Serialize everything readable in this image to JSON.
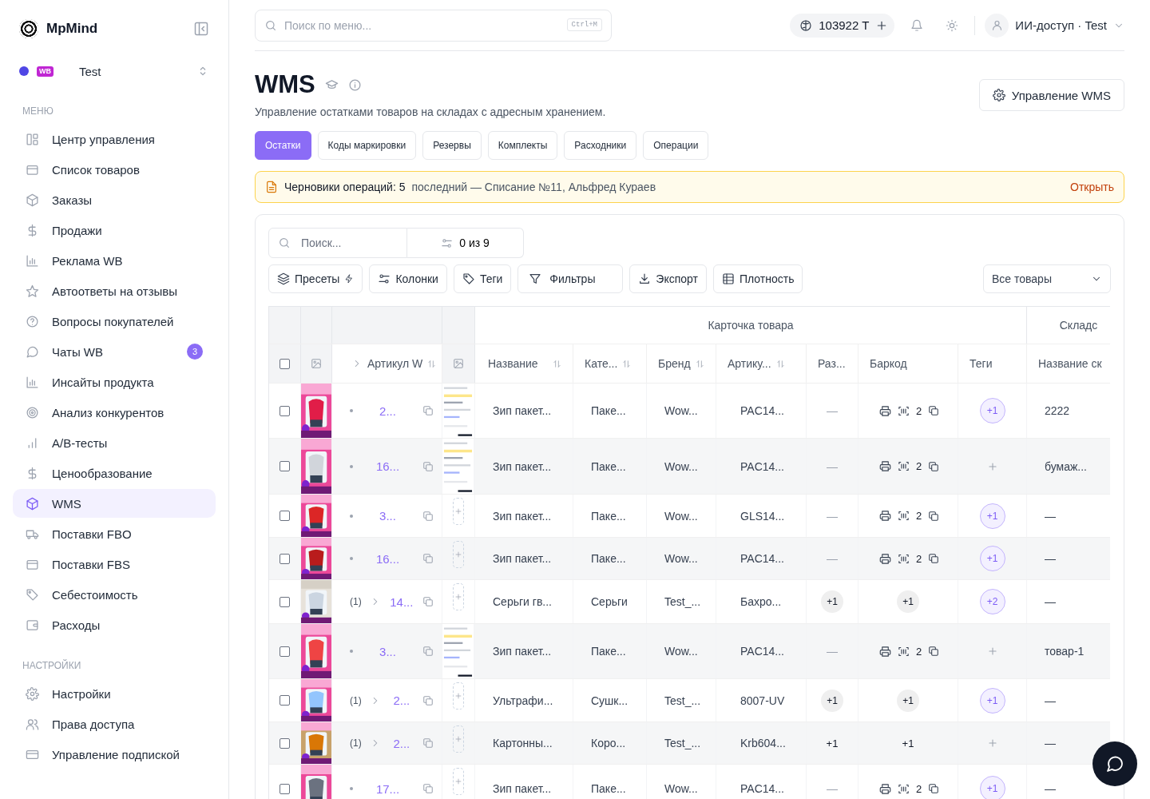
{
  "sidebar": {
    "brand": "MpMind",
    "account": {
      "name": "Test",
      "color": "#4f46e5",
      "marketplace": "WB"
    },
    "sections": [
      {
        "title": "МЕНЮ",
        "items": [
          {
            "label": "Центр управления",
            "selected": false
          },
          {
            "label": "Список товаров",
            "selected": false
          },
          {
            "label": "Заказы",
            "selected": false
          },
          {
            "label": "Продажи",
            "selected": false
          },
          {
            "label": "Реклама WB",
            "selected": false
          },
          {
            "label": "Автоответы на отзывы",
            "selected": false
          },
          {
            "label": "Вопросы покупателей",
            "selected": false
          },
          {
            "label": "Чаты WB",
            "selected": false,
            "badge": "3"
          },
          {
            "label": "Инсайты продукта",
            "selected": false
          },
          {
            "label": "Анализ конкурентов",
            "selected": false
          },
          {
            "label": "A/B-тесты",
            "selected": false
          },
          {
            "label": "Ценообразование",
            "selected": false
          },
          {
            "label": "WMS",
            "selected": true
          },
          {
            "label": "Поставки FBO",
            "selected": false
          },
          {
            "label": "Поставки FBS",
            "selected": false
          },
          {
            "label": "Себестоимость",
            "selected": false
          },
          {
            "label": "Расходы",
            "selected": false
          }
        ]
      },
      {
        "title": "НАСТРОЙКИ",
        "items": [
          {
            "label": "Настройки",
            "selected": false
          },
          {
            "label": "Права доступа",
            "selected": false
          },
          {
            "label": "Управление подпиской",
            "selected": false
          }
        ]
      }
    ]
  },
  "topbar": {
    "search": {
      "placeholder": "Поиск по меню...",
      "shortcut": "Ctrl+M"
    },
    "tokens": "103922 T",
    "user": "ИИ-доступ · Test"
  },
  "header": {
    "title": "WMS",
    "subtitle": "Управление остатками товаров на складах с адресным хранением.",
    "action": "Управление WMS"
  },
  "tabs": [
    {
      "label": "Остатки",
      "selected": true
    },
    {
      "label": "Коды маркировки",
      "selected": false
    },
    {
      "label": "Резервы",
      "selected": false
    },
    {
      "label": "Комплекты",
      "selected": false
    },
    {
      "label": "Расходники",
      "selected": false
    },
    {
      "label": "Операции",
      "selected": false
    }
  ],
  "notice": {
    "title": "Черновики операций: 5",
    "detail": "последний — Списание №11, Альфред Кураев",
    "action": "Открыть"
  },
  "toolbar": {
    "search": {
      "placeholder": "Поиск..."
    },
    "filter_count": "0 из 9",
    "buttons": [
      "Пресеты",
      "Колонки",
      "Теги",
      "Фильтры",
      "Экспорт",
      "Плотность"
    ],
    "scope": "Все товары"
  },
  "table": {
    "all_selected": false,
    "groups": [
      "Карточка товара",
      "Складс"
    ],
    "columns": [
      "Артикул W",
      "Название",
      "Кате...",
      "Бренд",
      "Артику...",
      "Раз...",
      "Баркод",
      "Теги",
      "Название ск"
    ],
    "rows": [
      {
        "selected": false,
        "group_count": null,
        "article": "2...",
        "has_image": true,
        "name": "Зип пакет...",
        "category": "Паке...",
        "brand": "Wow...",
        "vendor_code": "PAC14...",
        "size": {
          "kind": "dash",
          "text": "—"
        },
        "barcode": {
          "kind": "icons",
          "text": "2"
        },
        "tags": {
          "kind": "chip",
          "text": "+1"
        },
        "warehouse": "2222"
      },
      {
        "selected": false,
        "group_count": null,
        "article": "16...",
        "has_image": true,
        "name": "Зип пакет...",
        "category": "Паке...",
        "brand": "Wow...",
        "vendor_code": "PAC14...",
        "size": {
          "kind": "dash",
          "text": "—"
        },
        "barcode": {
          "kind": "icons",
          "text": "2"
        },
        "tags": {
          "kind": "add"
        },
        "warehouse": "бумаж..."
      },
      {
        "selected": false,
        "group_count": null,
        "article": "3...",
        "has_image": false,
        "name": "Зип пакет...",
        "category": "Паке...",
        "brand": "Wow...",
        "vendor_code": "GLS14...",
        "size": {
          "kind": "dash",
          "text": "—"
        },
        "barcode": {
          "kind": "icons",
          "text": "2"
        },
        "tags": {
          "kind": "chip",
          "text": "+1"
        },
        "warehouse": "—"
      },
      {
        "selected": false,
        "group_count": null,
        "article": "16...",
        "has_image": false,
        "name": "Зип пакет...",
        "category": "Паке...",
        "brand": "Wow...",
        "vendor_code": "PAC14...",
        "size": {
          "kind": "dash",
          "text": "—"
        },
        "barcode": {
          "kind": "icons",
          "text": "2"
        },
        "tags": {
          "kind": "chip",
          "text": "+1"
        },
        "warehouse": "—"
      },
      {
        "selected": false,
        "group_count": "(1)",
        "article": "14...",
        "has_image": false,
        "name": "Серьги гв...",
        "category": "Серьги",
        "brand": "Test_...",
        "vendor_code": "Бахро...",
        "size": {
          "kind": "chip",
          "text": "+1"
        },
        "barcode": {
          "kind": "chip",
          "text": "+1"
        },
        "tags": {
          "kind": "chip",
          "text": "+2"
        },
        "warehouse": "—"
      },
      {
        "selected": false,
        "group_count": null,
        "article": "3...",
        "has_image": true,
        "name": "Зип пакет...",
        "category": "Паке...",
        "brand": "Wow...",
        "vendor_code": "PAC14...",
        "size": {
          "kind": "dash",
          "text": "—"
        },
        "barcode": {
          "kind": "icons",
          "text": "2"
        },
        "tags": {
          "kind": "add"
        },
        "warehouse": "товар-1"
      },
      {
        "selected": false,
        "group_count": "(1)",
        "article": "2...",
        "has_image": false,
        "name": "Ультрафи...",
        "category": "Сушк...",
        "brand": "Test_...",
        "vendor_code": "8007-UV",
        "size": {
          "kind": "chip",
          "text": "+1"
        },
        "barcode": {
          "kind": "chip",
          "text": "+1"
        },
        "tags": {
          "kind": "chip",
          "text": "+1"
        },
        "warehouse": "—"
      },
      {
        "selected": false,
        "group_count": "(1)",
        "article": "2...",
        "has_image": false,
        "name": "Картонны...",
        "category": "Коро...",
        "brand": "Test_...",
        "vendor_code": "Krb604...",
        "size": {
          "kind": "plain",
          "text": "+1"
        },
        "barcode": {
          "kind": "plain",
          "text": "+1"
        },
        "tags": {
          "kind": "add"
        },
        "warehouse": "—"
      },
      {
        "selected": false,
        "group_count": null,
        "article": "17...",
        "has_image": false,
        "name": "Зип пакет...",
        "category": "Паке...",
        "brand": "Wow...",
        "vendor_code": "PAC14...",
        "size": {
          "kind": "dash",
          "text": "—"
        },
        "barcode": {
          "kind": "icons",
          "text": "2"
        },
        "tags": {
          "kind": "chip",
          "text": "+1"
        },
        "warehouse": "—"
      }
    ]
  }
}
